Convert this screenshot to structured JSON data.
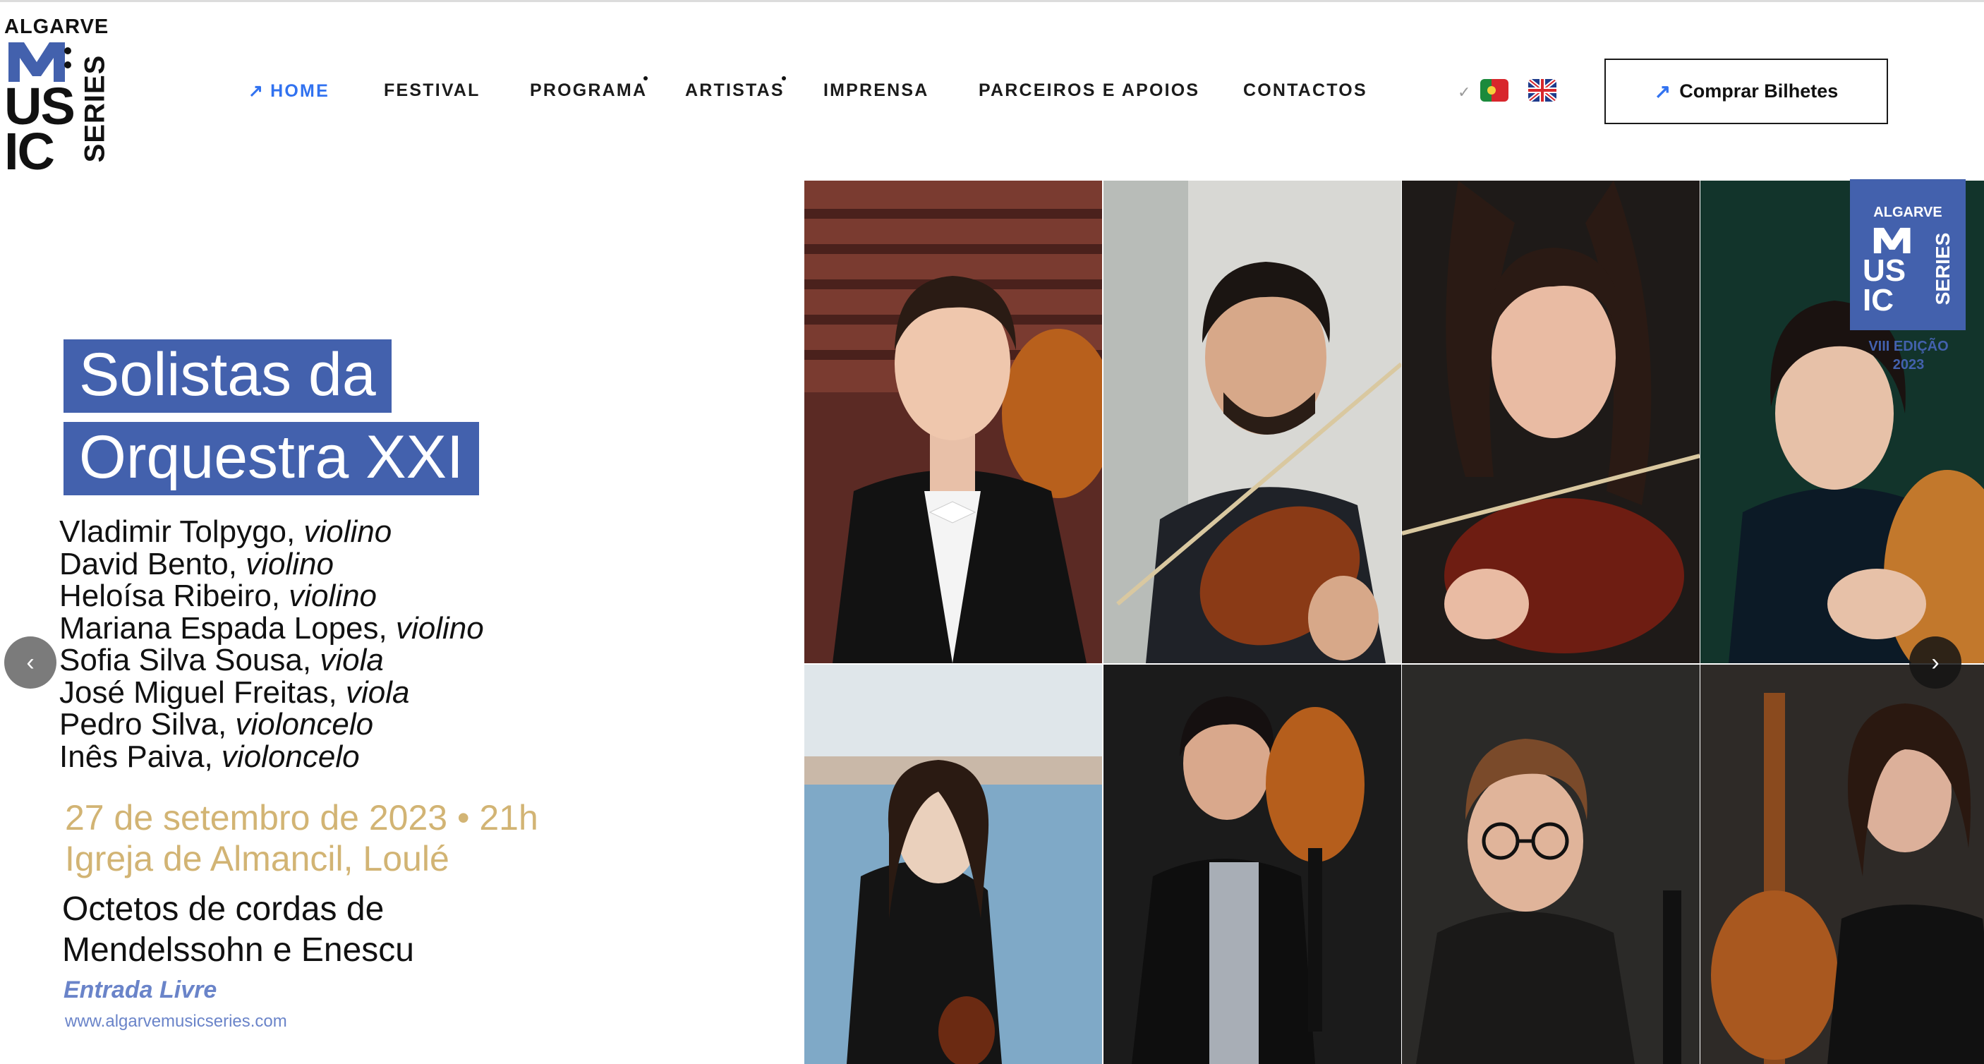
{
  "logo": {
    "top": "ALGARVE",
    "m": "M",
    "us": "US",
    "ic": "IC",
    "series": "SERIES"
  },
  "nav": {
    "items": [
      {
        "label": "HOME",
        "active": true
      },
      {
        "label": "FESTIVAL"
      },
      {
        "label": "PROGRAMA"
      },
      {
        "label": "ARTISTAS"
      },
      {
        "label": "IMPRENSA"
      },
      {
        "label": "PARCEIROS E APOIOS"
      },
      {
        "label": "CONTACTOS"
      }
    ],
    "arrow_icon": "↗",
    "active_color": "#3172f0"
  },
  "languages": [
    {
      "code": "pt",
      "icon": "flag-portugal-icon"
    },
    {
      "code": "en",
      "icon": "flag-uk-icon"
    }
  ],
  "cta": {
    "label": "Comprar Bilhetes",
    "icon": "arrow-up-right-icon"
  },
  "poster": {
    "title_line1": "Solistas da",
    "title_line2": "Orquestra XXI",
    "title_band_color": "#4361ad",
    "musicians": [
      {
        "name": "Vladimir Tolpygo,",
        "instrument": "violino"
      },
      {
        "name": "David Bento,",
        "instrument": "violino"
      },
      {
        "name": "Heloísa Ribeiro,",
        "instrument": "violino"
      },
      {
        "name": "Mariana Espada Lopes,",
        "instrument": "violino"
      },
      {
        "name": "Sofia Silva Sousa,",
        "instrument": "viola"
      },
      {
        "name": "José Miguel Freitas,",
        "instrument": "viola"
      },
      {
        "name": "Pedro Silva,",
        "instrument": "violoncelo"
      },
      {
        "name": "Inês Paiva,",
        "instrument": "violoncelo"
      }
    ],
    "date": "27 de setembro de 2023 • 21h",
    "venue": "Igreja de Almancil, Loulé",
    "program_line1": "Octetos de cordas de",
    "program_line2": "Mendelssohn e Enescu",
    "entry": "Entrada Livre",
    "website": "www.algarvemusicseries.com",
    "accent_gold": "#d2b474",
    "badge": {
      "top": "ALGARVE",
      "m": "M",
      "us": "US",
      "ic": "IC",
      "series": "SERIES",
      "edition_line1": "VIII EDIÇÃO",
      "edition_line2": "2023"
    }
  },
  "carousel": {
    "prev_icon": "chevron-left-icon",
    "next_icon": "chevron-right-icon"
  }
}
